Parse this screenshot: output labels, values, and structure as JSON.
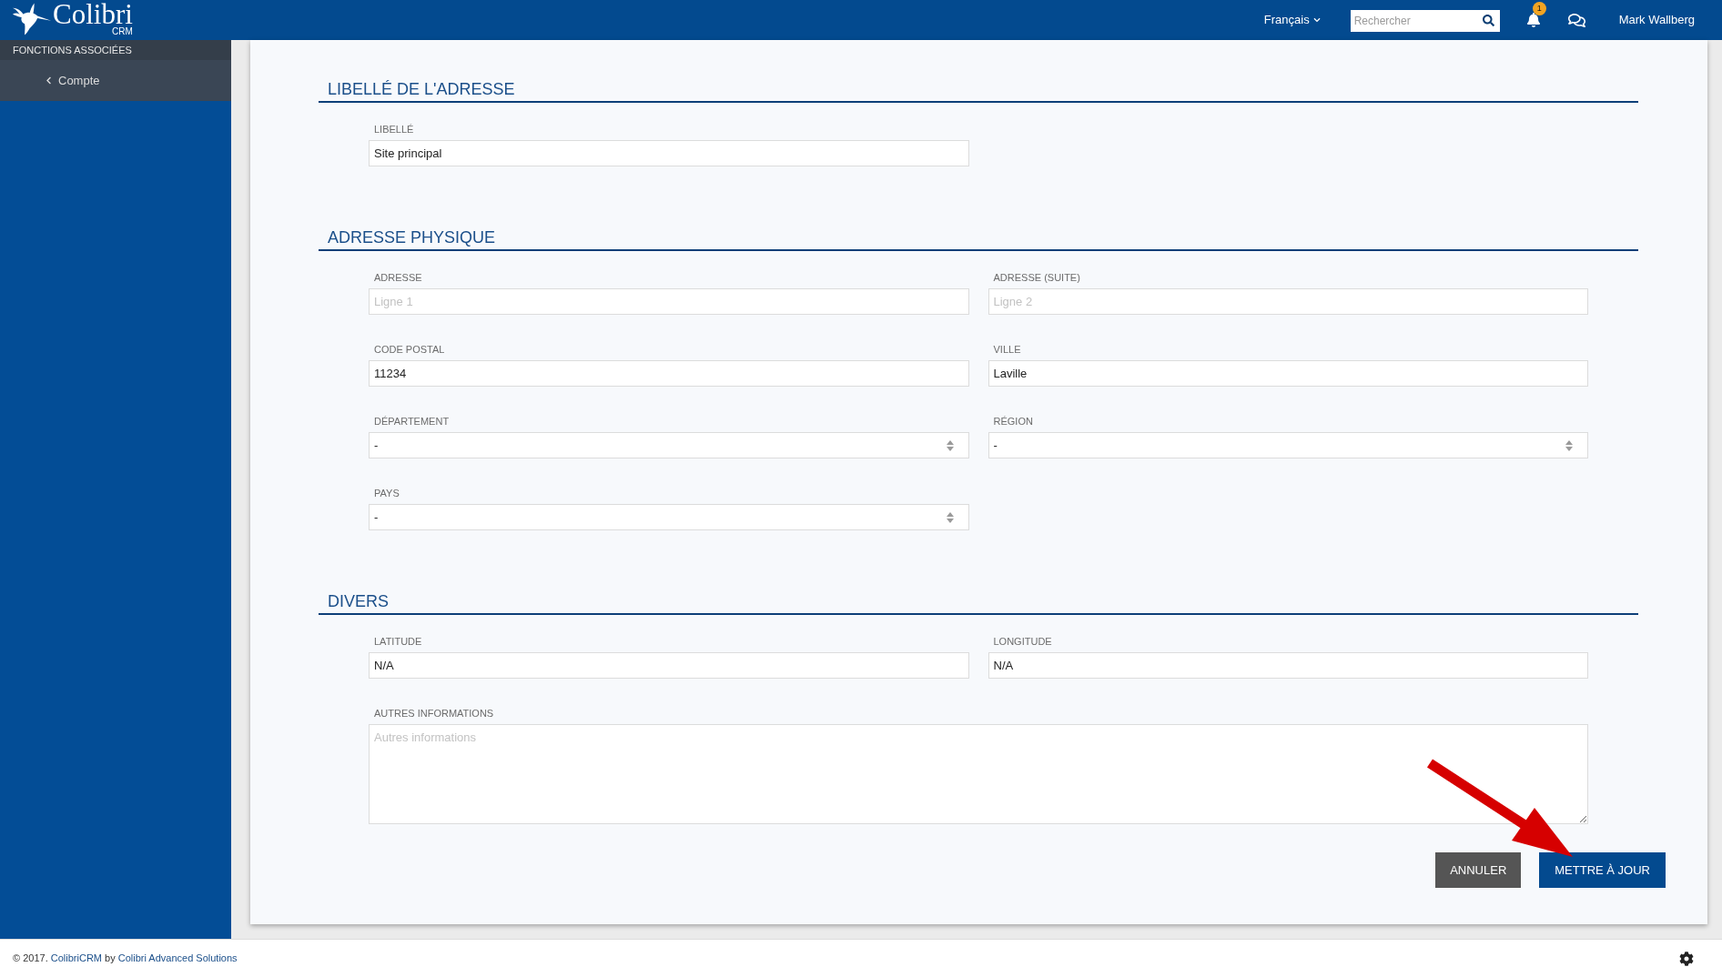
{
  "header": {
    "logo": {
      "name": "Colibri",
      "sub": "CRM"
    },
    "language": "Français",
    "search": {
      "placeholder": "Rechercher"
    },
    "notifications": {
      "badge": "1"
    },
    "user": "Mark Wallberg"
  },
  "sidebar": {
    "section_title": "FONCTIONS ASSOCIÉES",
    "back_link": "Compte"
  },
  "sections": [
    {
      "title": "LIBELLÉ DE L'ADRESSE",
      "fields": [
        {
          "kind": "text",
          "label": "LIBELLÉ",
          "value": "Site principal"
        }
      ]
    },
    {
      "title": "ADRESSE PHYSIQUE",
      "fields": [
        {
          "kind": "text",
          "label": "ADRESSE",
          "placeholder": "Ligne 1"
        },
        {
          "kind": "text",
          "label": "ADRESSE (SUITE)",
          "placeholder": "Ligne 2"
        },
        {
          "kind": "text",
          "label": "CODE POSTAL",
          "value": "11234"
        },
        {
          "kind": "text",
          "label": "VILLE",
          "value": "Laville"
        },
        {
          "kind": "select",
          "label": "DÉPARTEMENT",
          "value": "-"
        },
        {
          "kind": "select",
          "label": "RÉGION",
          "value": "-"
        },
        {
          "kind": "select",
          "label": "PAYS",
          "value": "-"
        }
      ]
    },
    {
      "title": "DIVERS",
      "fields": [
        {
          "kind": "text",
          "label": "LATITUDE",
          "value": "N/A"
        },
        {
          "kind": "text",
          "label": "LONGITUDE",
          "value": "N/A"
        },
        {
          "kind": "textarea",
          "label": "AUTRES INFORMATIONS",
          "placeholder": "Autres informations"
        }
      ]
    }
  ],
  "actions": [
    {
      "kind": "secondary",
      "label": "ANNULER"
    },
    {
      "kind": "primary",
      "label": "METTRE À JOUR"
    }
  ],
  "footer": {
    "text_1": "© 2017.",
    "product_link": "ColibriCRM",
    "text_2": "by",
    "company_link": "Colibri Advanced Solutions"
  }
}
